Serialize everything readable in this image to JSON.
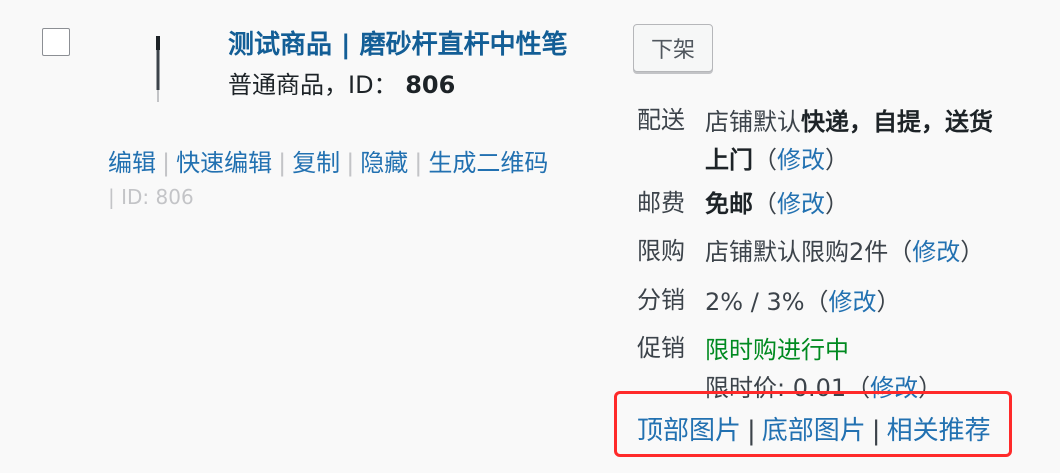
{
  "product": {
    "title": "测试商品 | 磨砂杆直杆中性笔",
    "type_label": "普通商品，ID：",
    "id": "806",
    "row_actions": [
      "编辑",
      "快速编辑",
      "复制",
      "隐藏",
      "生成二维码"
    ],
    "id_hint": "| ID: 806"
  },
  "status_button": "下架",
  "details": {
    "delivery_label": "配送",
    "delivery_prefix": "店铺默认",
    "delivery_bold_1": "快递，自提，送货",
    "delivery_bold_2": "上门",
    "shipping_fee_label": "邮费",
    "shipping_fee_value": "免邮",
    "limit_label": "限购",
    "limit_value": "店铺默认限购2件",
    "distribution_label": "分销",
    "distribution_value": "2% / 3%",
    "promotion_label": "促销",
    "promotion_status": "限时购进行中",
    "promotion_price": "限时价: 0.01",
    "modify_text": "（修改）",
    "modify_link": "修改"
  },
  "bottom_links": [
    "顶部图片",
    "底部图片",
    "相关推荐"
  ],
  "colors": {
    "link": "#2271b1",
    "title": "#135e96",
    "promotion_active": "#008a20",
    "highlight": "#ff2a2a"
  }
}
